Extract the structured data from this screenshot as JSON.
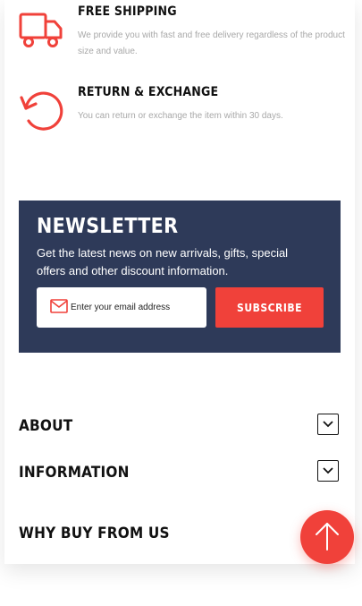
{
  "features": [
    {
      "title": "FREE SHIPPING",
      "description": "We provide you with fast and free delivery regardless of the product size and value.",
      "icon": "truck-icon"
    },
    {
      "title": "RETURN & EXCHANGE",
      "description": "You can return or exchange the item within 30 days.",
      "icon": "return-arrow-icon"
    }
  ],
  "newsletter": {
    "title": "NEWSLETTER",
    "text": "Get the latest news on new arrivals, gifts, special offers and other discount information.",
    "email_placeholder": "Enter your email address",
    "subscribe_label": "SUBSCRIBE"
  },
  "accordion": [
    {
      "label": "ABOUT"
    },
    {
      "label": "INFORMATION"
    },
    {
      "label": "WHY BUY FROM US"
    }
  ],
  "colors": {
    "accent": "#f0413a",
    "newsletter_bg": "#2e3a59"
  }
}
